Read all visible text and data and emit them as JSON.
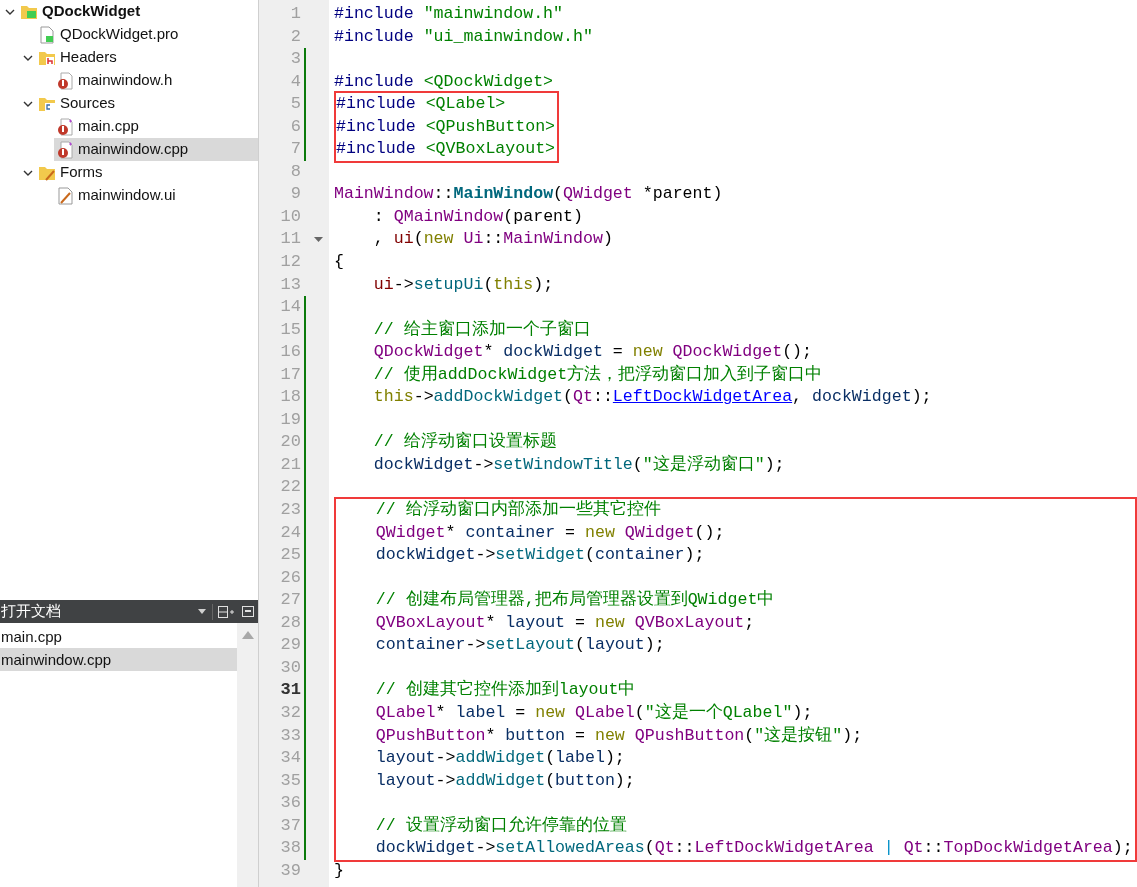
{
  "project_tree": [
    {
      "label": "QDockWidget",
      "kind": "project",
      "expanded": true,
      "selected": false,
      "children": [
        {
          "label": "QDockWidget.pro",
          "kind": "pro",
          "selected": false
        },
        {
          "label": "Headers",
          "kind": "headers",
          "expanded": true,
          "selected": false,
          "children": [
            {
              "label": "mainwindow.h",
              "kind": "header",
              "selected": false
            }
          ]
        },
        {
          "label": "Sources",
          "kind": "sources",
          "expanded": true,
          "selected": false,
          "children": [
            {
              "label": "main.cpp",
              "kind": "source",
              "selected": false
            },
            {
              "label": "mainwindow.cpp",
              "kind": "source",
              "selected": true
            }
          ]
        },
        {
          "label": "Forms",
          "kind": "forms",
          "expanded": true,
          "selected": false,
          "children": [
            {
              "label": "mainwindow.ui",
              "kind": "form",
              "selected": false
            }
          ]
        }
      ]
    }
  ],
  "open_documents": {
    "title": "打开文档",
    "items": [
      {
        "label": "main.cpp",
        "selected": false
      },
      {
        "label": "mainwindow.cpp",
        "selected": true
      }
    ]
  },
  "editor": {
    "blocks": [
      {
        "framed": false,
        "lines": [
          {
            "number": "1",
            "changed": false,
            "current": false,
            "foldable": false,
            "tokens": [
              {
                "kind": "macro",
                "text": "#include"
              },
              {
                "kind": "string",
                "text": " \"mainwindow.h\""
              }
            ]
          },
          {
            "number": "2",
            "changed": false,
            "current": false,
            "foldable": false,
            "tokens": [
              {
                "kind": "macro",
                "text": "#include"
              },
              {
                "kind": "string",
                "text": " \"ui_mainwindow.h\""
              }
            ]
          },
          {
            "number": "3",
            "changed": true,
            "current": false,
            "foldable": false
          },
          {
            "number": "4",
            "changed": true,
            "current": false,
            "foldable": false,
            "tokens": [
              {
                "kind": "macro",
                "text": "#include"
              },
              {
                "kind": "string",
                "text": " <QDockWidget>"
              }
            ]
          }
        ]
      },
      {
        "framed": true,
        "lines": [
          {
            "number": "5",
            "changed": true,
            "current": false,
            "foldable": false,
            "tokens": [
              {
                "kind": "macro",
                "text": "#include"
              },
              {
                "kind": "string",
                "text": " <QLabel>"
              }
            ]
          },
          {
            "number": "6",
            "changed": true,
            "current": false,
            "foldable": false,
            "tokens": [
              {
                "kind": "macro",
                "text": "#include"
              },
              {
                "kind": "string",
                "text": " <QPushButton>"
              }
            ]
          },
          {
            "number": "7",
            "changed": true,
            "current": false,
            "foldable": false,
            "tokens": [
              {
                "kind": "macro",
                "text": "#include"
              },
              {
                "kind": "string",
                "text": " <QVBoxLayout>"
              }
            ]
          }
        ]
      },
      {
        "framed": false,
        "lines": [
          {
            "number": "8",
            "changed": false,
            "current": false,
            "foldable": false
          },
          {
            "number": "9",
            "changed": false,
            "current": false,
            "foldable": false,
            "tokens": [
              {
                "kind": "type",
                "text": "MainWindow"
              },
              {
                "kind": "plain",
                "text": "::"
              },
              {
                "kind": "decl",
                "text": "MainWindow"
              },
              {
                "kind": "plain",
                "text": "("
              },
              {
                "kind": "type",
                "text": "QWidget"
              },
              {
                "kind": "plain",
                "text": " *parent)"
              }
            ]
          },
          {
            "number": "10",
            "changed": false,
            "current": false,
            "foldable": false,
            "tokens": [
              {
                "kind": "plain",
                "text": "    : "
              },
              {
                "kind": "type",
                "text": "QMainWindow"
              },
              {
                "kind": "plain",
                "text": "(parent)"
              }
            ]
          },
          {
            "number": "11",
            "changed": false,
            "current": false,
            "foldable": true,
            "tokens": [
              {
                "kind": "plain",
                "text": "    , "
              },
              {
                "kind": "field",
                "text": "ui"
              },
              {
                "kind": "plain",
                "text": "("
              },
              {
                "kind": "keyword",
                "text": "new"
              },
              {
                "kind": "type",
                "text": " Ui"
              },
              {
                "kind": "plain",
                "text": "::"
              },
              {
                "kind": "type",
                "text": "MainWindow"
              },
              {
                "kind": "plain",
                "text": ")"
              }
            ]
          },
          {
            "number": "12",
            "changed": false,
            "current": false,
            "foldable": false,
            "tokens": [
              {
                "kind": "plain",
                "text": "{"
              }
            ]
          },
          {
            "number": "13",
            "changed": false,
            "current": false,
            "foldable": false,
            "tokens": [
              {
                "kind": "field",
                "text": "    ui"
              },
              {
                "kind": "plain",
                "text": "->"
              },
              {
                "kind": "func",
                "text": "setupUi"
              },
              {
                "kind": "plain",
                "text": "("
              },
              {
                "kind": "keyword",
                "text": "this"
              },
              {
                "kind": "plain",
                "text": ");"
              }
            ]
          },
          {
            "number": "14",
            "changed": true,
            "current": false,
            "foldable": false
          },
          {
            "number": "15",
            "changed": true,
            "current": false,
            "foldable": false,
            "tokens": [
              {
                "kind": "comment",
                "text": "    // 给主窗口添加一个子窗口"
              }
            ]
          },
          {
            "number": "16",
            "changed": true,
            "current": false,
            "foldable": false,
            "tokens": [
              {
                "kind": "type",
                "text": "    QDockWidget"
              },
              {
                "kind": "plain",
                "text": "* "
              },
              {
                "kind": "var",
                "text": "dockWidget"
              },
              {
                "kind": "plain",
                "text": " = "
              },
              {
                "kind": "keyword",
                "text": "new"
              },
              {
                "kind": "type",
                "text": " QDockWidget"
              },
              {
                "kind": "plain",
                "text": "();"
              }
            ]
          },
          {
            "number": "17",
            "changed": true,
            "current": false,
            "foldable": false,
            "tokens": [
              {
                "kind": "comment",
                "text": "    // 使用addDockWidget方法，把浮动窗口加入到子窗口中"
              }
            ]
          },
          {
            "number": "18",
            "changed": true,
            "current": false,
            "foldable": false,
            "tokens": [
              {
                "kind": "keyword",
                "text": "    this"
              },
              {
                "kind": "plain",
                "text": "->"
              },
              {
                "kind": "func",
                "text": "addDockWidget"
              },
              {
                "kind": "plain",
                "text": "("
              },
              {
                "kind": "type",
                "text": "Qt"
              },
              {
                "kind": "plain",
                "text": "::"
              },
              {
                "kind": "link",
                "text": "LeftDockWidgetArea"
              },
              {
                "kind": "plain",
                "text": ", "
              },
              {
                "kind": "var",
                "text": "dockWidget"
              },
              {
                "kind": "plain",
                "text": ");"
              }
            ]
          },
          {
            "number": "19",
            "changed": true,
            "current": false,
            "foldable": false
          },
          {
            "number": "20",
            "changed": true,
            "current": false,
            "foldable": false,
            "tokens": [
              {
                "kind": "comment",
                "text": "    // 给浮动窗口设置标题"
              }
            ]
          },
          {
            "number": "21",
            "changed": true,
            "current": false,
            "foldable": false,
            "tokens": [
              {
                "kind": "var",
                "text": "    dockWidget"
              },
              {
                "kind": "plain",
                "text": "->"
              },
              {
                "kind": "func",
                "text": "setWindowTitle"
              },
              {
                "kind": "plain",
                "text": "("
              },
              {
                "kind": "string",
                "text": "\"这是浮动窗口\""
              },
              {
                "kind": "plain",
                "text": ");"
              }
            ]
          },
          {
            "number": "22",
            "changed": true,
            "current": false,
            "foldable": false
          }
        ]
      },
      {
        "framed": true,
        "lines": [
          {
            "number": "23",
            "changed": true,
            "current": false,
            "foldable": false,
            "tokens": [
              {
                "kind": "comment",
                "text": "    // 给浮动窗口内部添加一些其它控件"
              }
            ]
          },
          {
            "number": "24",
            "changed": true,
            "current": false,
            "foldable": false,
            "tokens": [
              {
                "kind": "type",
                "text": "    QWidget"
              },
              {
                "kind": "plain",
                "text": "* "
              },
              {
                "kind": "var",
                "text": "container"
              },
              {
                "kind": "plain",
                "text": " = "
              },
              {
                "kind": "keyword",
                "text": "new"
              },
              {
                "kind": "type",
                "text": " QWidget"
              },
              {
                "kind": "plain",
                "text": "();"
              }
            ]
          },
          {
            "number": "25",
            "changed": true,
            "current": false,
            "foldable": false,
            "tokens": [
              {
                "kind": "var",
                "text": "    dockWidget"
              },
              {
                "kind": "plain",
                "text": "->"
              },
              {
                "kind": "func",
                "text": "setWidget"
              },
              {
                "kind": "plain",
                "text": "("
              },
              {
                "kind": "var",
                "text": "container"
              },
              {
                "kind": "plain",
                "text": ");"
              }
            ]
          },
          {
            "number": "26",
            "changed": true,
            "current": false,
            "foldable": false
          },
          {
            "number": "27",
            "changed": true,
            "current": false,
            "foldable": false,
            "tokens": [
              {
                "kind": "comment",
                "text": "    // 创建布局管理器,把布局管理器设置到QWidget中"
              }
            ]
          },
          {
            "number": "28",
            "changed": true,
            "current": false,
            "foldable": false,
            "tokens": [
              {
                "kind": "type",
                "text": "    QVBoxLayout"
              },
              {
                "kind": "plain",
                "text": "* "
              },
              {
                "kind": "var",
                "text": "layout"
              },
              {
                "kind": "plain",
                "text": " = "
              },
              {
                "kind": "keyword",
                "text": "new"
              },
              {
                "kind": "type",
                "text": " QVBoxLayout"
              },
              {
                "kind": "plain",
                "text": ";"
              }
            ]
          },
          {
            "number": "29",
            "changed": true,
            "current": false,
            "foldable": false,
            "tokens": [
              {
                "kind": "var",
                "text": "    container"
              },
              {
                "kind": "plain",
                "text": "->"
              },
              {
                "kind": "func",
                "text": "setLayout"
              },
              {
                "kind": "plain",
                "text": "("
              },
              {
                "kind": "var",
                "text": "layout"
              },
              {
                "kind": "plain",
                "text": ");"
              }
            ]
          },
          {
            "number": "30",
            "changed": true,
            "current": false,
            "foldable": false
          },
          {
            "number": "31",
            "changed": true,
            "current": true,
            "foldable": false,
            "tokens": [
              {
                "kind": "comment",
                "text": "    // 创建其它控件添加到layout中"
              }
            ]
          },
          {
            "number": "32",
            "changed": true,
            "current": false,
            "foldable": false,
            "tokens": [
              {
                "kind": "type",
                "text": "    QLabel"
              },
              {
                "kind": "plain",
                "text": "* "
              },
              {
                "kind": "var",
                "text": "label"
              },
              {
                "kind": "plain",
                "text": " = "
              },
              {
                "kind": "keyword",
                "text": "new"
              },
              {
                "kind": "type",
                "text": " QLabel"
              },
              {
                "kind": "plain",
                "text": "("
              },
              {
                "kind": "string",
                "text": "\"这是一个QLabel\""
              },
              {
                "kind": "plain",
                "text": ");"
              }
            ]
          },
          {
            "number": "33",
            "changed": true,
            "current": false,
            "foldable": false,
            "tokens": [
              {
                "kind": "type",
                "text": "    QPushButton"
              },
              {
                "kind": "plain",
                "text": "* "
              },
              {
                "kind": "var",
                "text": "button"
              },
              {
                "kind": "plain",
                "text": " = "
              },
              {
                "kind": "keyword",
                "text": "new"
              },
              {
                "kind": "type",
                "text": " QPushButton"
              },
              {
                "kind": "plain",
                "text": "("
              },
              {
                "kind": "string",
                "text": "\"这是按钮\""
              },
              {
                "kind": "plain",
                "text": ");"
              }
            ]
          },
          {
            "number": "34",
            "changed": true,
            "current": false,
            "foldable": false,
            "tokens": [
              {
                "kind": "var",
                "text": "    layout"
              },
              {
                "kind": "plain",
                "text": "->"
              },
              {
                "kind": "func",
                "text": "addWidget"
              },
              {
                "kind": "plain",
                "text": "("
              },
              {
                "kind": "var",
                "text": "label"
              },
              {
                "kind": "plain",
                "text": ");"
              }
            ]
          },
          {
            "number": "35",
            "changed": true,
            "current": false,
            "foldable": false,
            "tokens": [
              {
                "kind": "var",
                "text": "    layout"
              },
              {
                "kind": "plain",
                "text": "->"
              },
              {
                "kind": "func",
                "text": "addWidget"
              },
              {
                "kind": "plain",
                "text": "("
              },
              {
                "kind": "var",
                "text": "button"
              },
              {
                "kind": "plain",
                "text": ");"
              }
            ]
          },
          {
            "number": "36",
            "changed": true,
            "current": false,
            "foldable": false
          },
          {
            "number": "37",
            "changed": true,
            "current": false,
            "foldable": false,
            "tokens": [
              {
                "kind": "comment",
                "text": "    // 设置浮动窗口允许停靠的位置"
              }
            ]
          },
          {
            "number": "38",
            "changed": true,
            "current": false,
            "foldable": false,
            "tokens": [
              {
                "kind": "var",
                "text": "    dockWidget"
              },
              {
                "kind": "plain",
                "text": "->"
              },
              {
                "kind": "func",
                "text": "setAllowedAreas"
              },
              {
                "kind": "plain",
                "text": "("
              },
              {
                "kind": "type",
                "text": "Qt"
              },
              {
                "kind": "plain",
                "text": "::"
              },
              {
                "kind": "enum",
                "text": "LeftDockWidgetArea"
              },
              {
                "kind": "op",
                "text": " | "
              },
              {
                "kind": "type",
                "text": "Qt"
              },
              {
                "kind": "plain",
                "text": "::"
              },
              {
                "kind": "enum",
                "text": "TopDockWidgetArea"
              },
              {
                "kind": "plain",
                "text": ");"
              }
            ]
          }
        ]
      },
      {
        "framed": false,
        "lines": [
          {
            "number": "39",
            "changed": false,
            "current": false,
            "foldable": false,
            "tokens": [
              {
                "kind": "plain",
                "text": "}"
              }
            ]
          }
        ]
      }
    ]
  }
}
